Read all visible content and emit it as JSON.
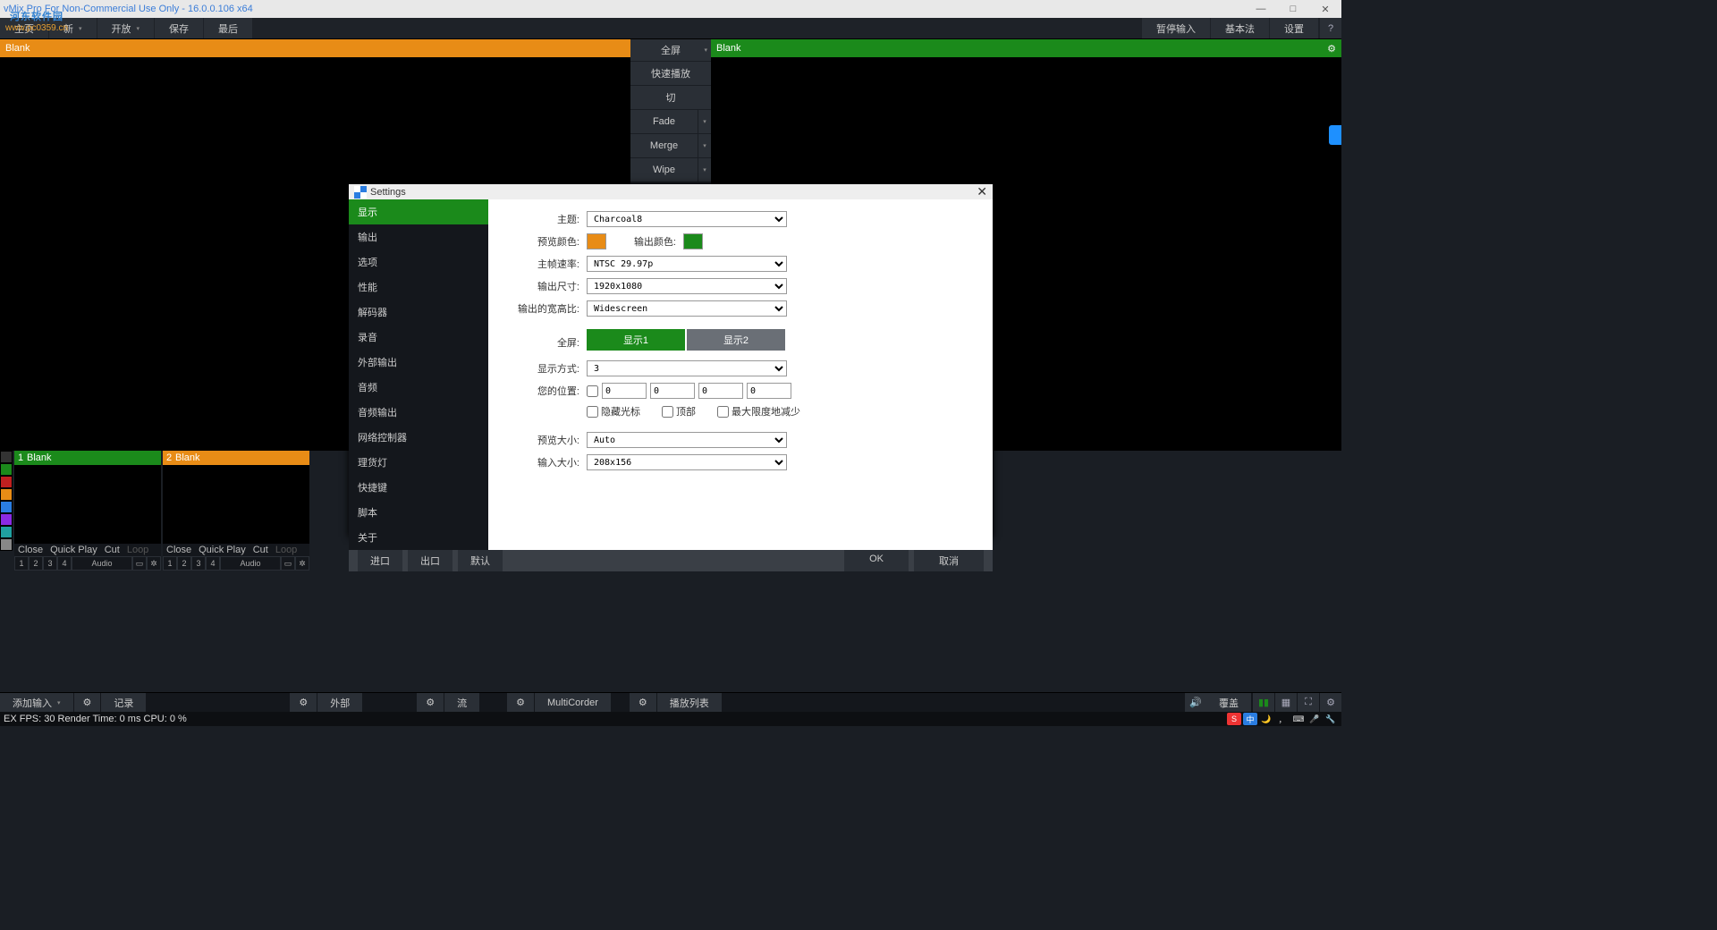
{
  "window": {
    "title": "vMix Pro For Non-Commercial Use Only - 16.0.0.106 x64"
  },
  "watermark": {
    "line1": "河东软件园",
    "line2": "www.pc0359.cn"
  },
  "toolbar": {
    "home": "主页",
    "new": "新",
    "open": "开放",
    "save": "保存",
    "last": "最后",
    "fullscreen": "全屏",
    "pause_in": "暂停输入",
    "basic": "基本法",
    "settings": "设置",
    "help": "?"
  },
  "preview": {
    "left_label": "Blank",
    "right_label": "Blank"
  },
  "transitions": {
    "quick": "快速播放",
    "cut": "切",
    "fade": "Fade",
    "merge": "Merge",
    "wipe": "Wipe"
  },
  "inputs": {
    "card1": {
      "num": "1",
      "name": "Blank"
    },
    "card2": {
      "num": "2",
      "name": "Blank"
    },
    "close": "Close",
    "quick": "Quick Play",
    "cut": "Cut",
    "loop": "Loop",
    "b1": "1",
    "b2": "2",
    "b3": "3",
    "b4": "4",
    "audio": "Audio"
  },
  "bottom": {
    "add_input": "添加输入",
    "record": "记录",
    "external": "外部",
    "stream": "流",
    "multicorder": "MultiCorder",
    "playlist": "播放列表",
    "overlay": "覆盖"
  },
  "status": {
    "text": "EX  FPS:  30   Render Time:  0 ms   CPU:  0 %"
  },
  "settings_dialog": {
    "title": "Settings",
    "side": [
      "显示",
      "输出",
      "选项",
      "性能",
      "解码器",
      "录音",
      "外部输出",
      "音频",
      "音频输出",
      "网络控制器",
      "理货灯",
      "快捷键",
      "脚本",
      "关于"
    ],
    "labels": {
      "theme": "主题:",
      "preview_color": "预览颜色:",
      "output_color": "输出颜色:",
      "framerate": "主帧速率:",
      "output_size": "输出尺寸:",
      "aspect": "输出的宽高比:",
      "fullscreen": "全屏:",
      "display1": "显示1",
      "display2": "显示2",
      "display_mode": "显示方式:",
      "your_pos": "您的位置:",
      "hide_cursor": "隐藏光标",
      "top": "顶部",
      "minimize": "最大限度地减少",
      "preview_size": "预览大小:",
      "input_size": "输入大小:"
    },
    "values": {
      "theme": "Charcoal8",
      "framerate": "NTSC 29.97p",
      "output_size": "1920x1080",
      "aspect": "Widescreen",
      "display_mode": "3",
      "pos0": "0",
      "pos1": "0",
      "pos2": "0",
      "pos3": "0",
      "preview_size": "Auto",
      "input_size": "208x156"
    },
    "colors": {
      "preview": "#e88c16",
      "output": "#1b8a1b"
    },
    "footer": {
      "import": "进口",
      "export": "出口",
      "default": "默认",
      "ok": "OK",
      "cancel": "取消"
    }
  }
}
